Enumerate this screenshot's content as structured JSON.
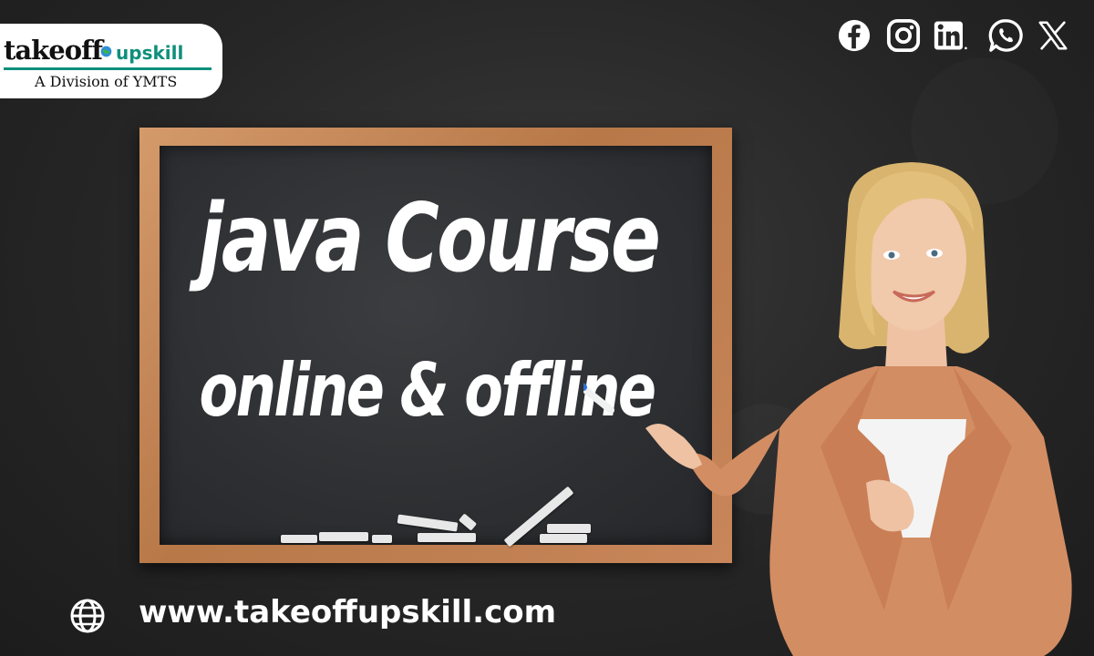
{
  "logo": {
    "brand_main": "takeoff",
    "brand_accent": "upskill",
    "tagline": "A Division of YMTS",
    "accent_color": "#0f8f7c"
  },
  "socials": [
    {
      "name": "facebook-icon"
    },
    {
      "name": "instagram-icon"
    },
    {
      "name": "linkedin-icon"
    },
    {
      "name": "whatsapp-icon"
    },
    {
      "name": "x-icon"
    }
  ],
  "board": {
    "line1": "java Course",
    "line2": "online & offline"
  },
  "footer": {
    "icon": "globe-icon",
    "url": "www.takeoffupskill.com"
  }
}
